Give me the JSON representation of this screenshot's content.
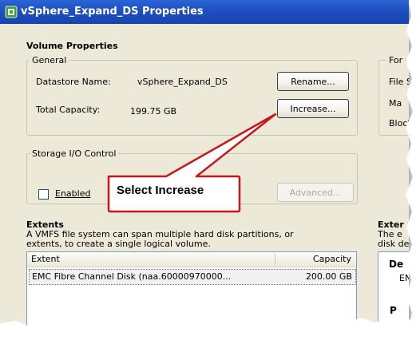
{
  "window": {
    "title": "vSphere_Expand_DS Properties"
  },
  "volume_properties": {
    "heading": "Volume Properties",
    "general": {
      "legend": "General",
      "datastore_label": "Datastore Name:",
      "datastore_value": "vSphere_Expand_DS",
      "capacity_label": "Total Capacity:",
      "capacity_value": "199.75 GB",
      "rename_button": "Rename...",
      "increase_button": "Increase..."
    },
    "storage_io": {
      "legend": "Storage I/O Control",
      "enabled_label": "Enabled",
      "enabled_checked": false,
      "advanced_button": "Advanced..."
    }
  },
  "extents": {
    "heading": "Extents",
    "description_line1": "A VMFS file system can span multiple hard disk partitions, or",
    "description_line2": "extents, to create a single logical volume.",
    "columns": [
      "Extent",
      "Capacity"
    ],
    "rows": [
      {
        "extent": "EMC Fibre Channel Disk (naa.60000970000...",
        "capacity": "200.00 GB"
      }
    ]
  },
  "right_panel_fragments": {
    "format_legend": "For",
    "file_system": "File S",
    "max": "Ma",
    "block": "Block",
    "extent_heading": "Exter",
    "desc_line1": "The e",
    "desc_line2": "disk de",
    "device_heading": "De",
    "device_value": "EN",
    "p_label": "P"
  },
  "callout": {
    "text": "Select Increase",
    "color": "#c8161d"
  }
}
